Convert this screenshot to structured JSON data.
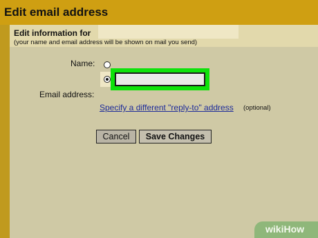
{
  "window": {
    "title": "Edit email address"
  },
  "info": {
    "heading": "Edit information for",
    "note": "(your name and email address will be shown on mail you send)"
  },
  "form": {
    "name_label": "Name:",
    "email_label": "Email address:",
    "name_value": "",
    "reply_to_link": "Specify a different \"reply-to\" address",
    "optional_note": "(optional)"
  },
  "buttons": {
    "cancel": "Cancel",
    "save": "Save Changes"
  },
  "watermark": {
    "text": "wikiHow"
  },
  "colors": {
    "highlight": "#0ee20a",
    "title_bar": "#cf9f12",
    "link": "#1c2a9a"
  }
}
